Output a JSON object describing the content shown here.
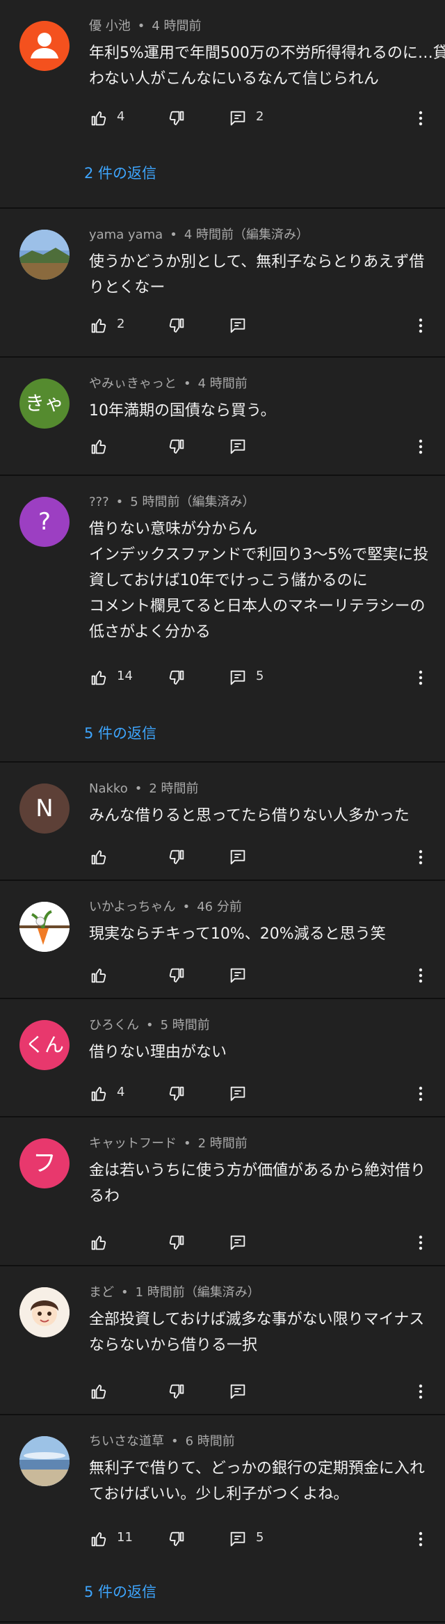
{
  "comments": [
    {
      "author": "優 小池",
      "time": "4 時間前",
      "edited": "",
      "avatar": {
        "type": "icon",
        "icon": "person-icon",
        "color": "#f4511e",
        "letter": ""
      },
      "lines": [
        "年利5%運用で年間500万の不労所得得れるのに…貸",
        "わない人がこんなにいるなんて信じられん"
      ],
      "likes": "4",
      "replies_count": "2",
      "replies_label": "2 件の返信"
    },
    {
      "author": "yama yama",
      "time": "4 時間前",
      "edited": "（編集済み）",
      "avatar": {
        "type": "image",
        "icon": "landscape-photo",
        "color": "#6f8fb8",
        "letter": ""
      },
      "lines": [
        "使うかどうか別として、無利子ならとりあえず借",
        "りとくなー"
      ],
      "likes": "2",
      "replies_count": "",
      "replies_label": ""
    },
    {
      "author": "やみぃきゃっと",
      "time": "4 時間前",
      "edited": "",
      "avatar": {
        "type": "letter",
        "icon": "",
        "color": "#558b2f",
        "letter": "きゃ"
      },
      "lines": [
        "10年満期の国債なら買う。"
      ],
      "likes": "",
      "replies_count": "",
      "replies_label": ""
    },
    {
      "author": "???",
      "time": "5 時間前",
      "edited": "（編集済み）",
      "avatar": {
        "type": "letter",
        "icon": "",
        "color": "#9c3fc2",
        "letter": "?"
      },
      "lines": [
        "借りない意味が分からん",
        "インデックスファンドで利回り3〜5%で堅実に投",
        "資しておけば10年でけっこう儲かるのに",
        "コメント欄見てると日本人のマネーリテラシーの",
        "低さがよく分かる"
      ],
      "likes": "14",
      "replies_count": "5",
      "replies_label": "5 件の返信"
    },
    {
      "author": "Nakko",
      "time": "2 時間前",
      "edited": "",
      "avatar": {
        "type": "letter",
        "icon": "",
        "color": "#5d4037",
        "letter": "N"
      },
      "lines": [
        "みんな借りると思ってたら借りない人多かった"
      ],
      "likes": "",
      "replies_count": "",
      "replies_label": ""
    },
    {
      "author": "いかよっちゃん",
      "time": "46 分前",
      "edited": "",
      "avatar": {
        "type": "image",
        "icon": "carrot-illustration",
        "color": "#ffffff",
        "letter": ""
      },
      "lines": [
        "現実ならチキって10%、20%減ると思う笑"
      ],
      "likes": "",
      "replies_count": "",
      "replies_label": ""
    },
    {
      "author": "ひろくん",
      "time": "5 時間前",
      "edited": "",
      "avatar": {
        "type": "letter",
        "icon": "",
        "color": "#e8386d",
        "letter": "くん"
      },
      "lines": [
        "借りない理由がない"
      ],
      "likes": "4",
      "replies_count": "",
      "replies_label": ""
    },
    {
      "author": "キャットフード",
      "time": "2 時間前",
      "edited": "",
      "avatar": {
        "type": "letter",
        "icon": "",
        "color": "#e8386d",
        "letter": "フ"
      },
      "lines": [
        "金は若いうちに使う方が価値があるから絶対借り",
        "るわ"
      ],
      "likes": "",
      "replies_count": "",
      "replies_label": ""
    },
    {
      "author": "まど",
      "time": "1 時間前",
      "edited": "（編集済み）",
      "avatar": {
        "type": "image",
        "icon": "anime-character-avatar",
        "color": "#f2e6d8",
        "letter": ""
      },
      "lines": [
        "全部投資しておけば滅多な事がない限りマイナス",
        "ならないから借りる一択"
      ],
      "likes": "",
      "replies_count": "",
      "replies_label": ""
    },
    {
      "author": "ちいさな道草",
      "time": "6 時間前",
      "edited": "",
      "avatar": {
        "type": "image",
        "icon": "seaside-photo",
        "color": "#8fb1d4",
        "letter": ""
      },
      "lines": [
        "無利子で借りて、どっかの銀行の定期預金に入れ",
        "ておけばいい。少し利子がつくよね。"
      ],
      "likes": "11",
      "replies_count": "5",
      "replies_label": "5 件の返信"
    }
  ]
}
